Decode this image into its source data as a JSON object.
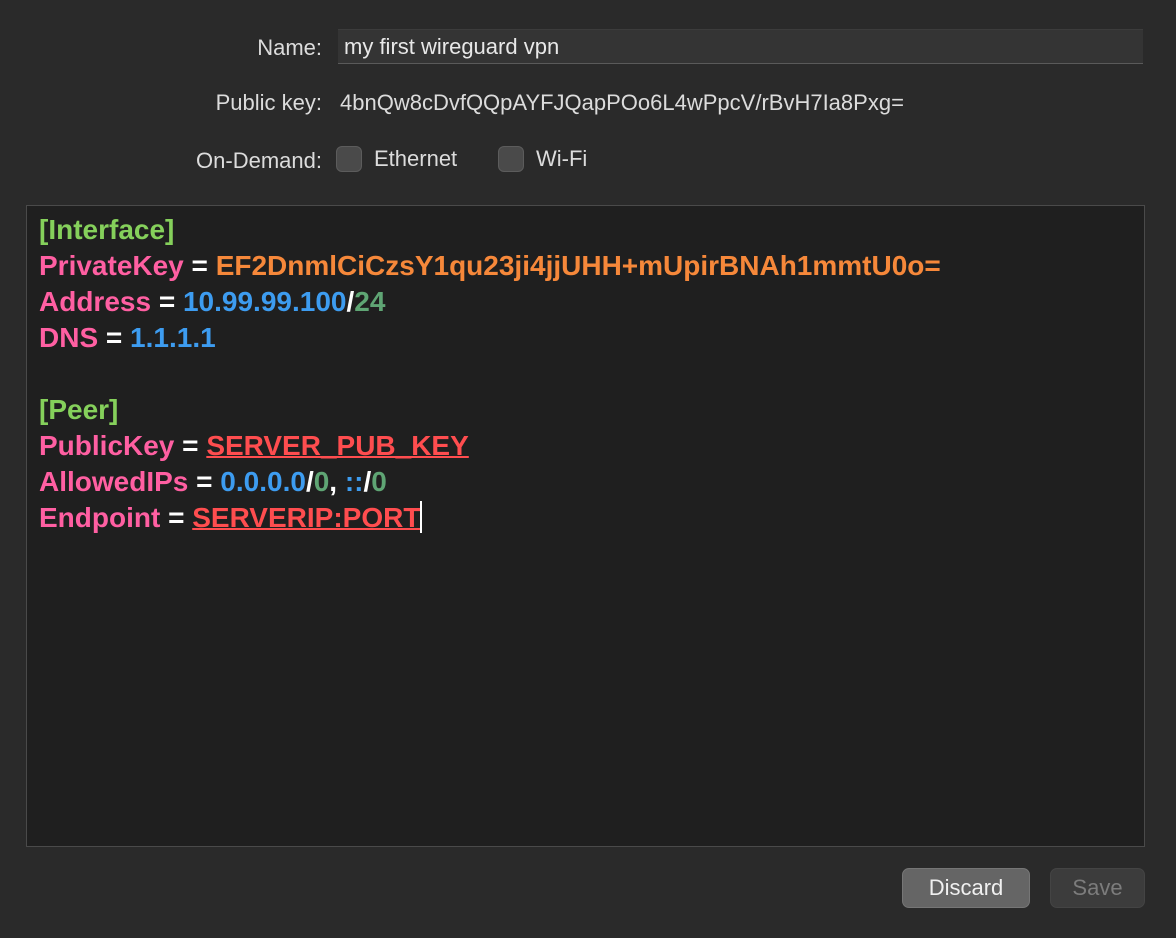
{
  "form": {
    "name_label": "Name:",
    "name_value": "my first wireguard vpn",
    "pubkey_label": "Public key:",
    "pubkey_value": "4bnQw8cDvfQQpAYFJQapPOo6L4wPpcV/rBvH7Ia8Pxg=",
    "ondemand_label": "On-Demand:",
    "ethernet_label": "Ethernet",
    "ethernet_checked": false,
    "wifi_label": "Wi-Fi",
    "wifi_checked": false
  },
  "config": {
    "interface_header": "[Interface]",
    "private_key_key": "PrivateKey",
    "private_key_value": "EF2DnmlCiCzsY1qu23ji4jjUHH+mUpirBNAh1mmtU0o=",
    "address_key": "Address",
    "address_ip": "10.99.99.100",
    "address_slash": "/",
    "address_prefix": "24",
    "dns_key": "DNS",
    "dns_value": "1.1.1.1",
    "peer_header": "[Peer]",
    "public_key_key": "PublicKey",
    "public_key_value": "SERVER_PUB_KEY",
    "allowed_ips_key": "AllowedIPs",
    "allowed_ip4": "0.0.0.0",
    "allowed_ip4_prefix": "0",
    "allowed_ip6": "::",
    "allowed_ip6_prefix": "0",
    "endpoint_key": "Endpoint",
    "endpoint_value": "SERVERIP:PORT",
    "equals": " = ",
    "comma": ", "
  },
  "buttons": {
    "discard_label": "Discard",
    "save_label": "Save"
  },
  "colors": {
    "background": "#2a2a2a",
    "editor_background": "#1f1f1f",
    "section": "#85d05b",
    "key": "#ff5fa2",
    "private_key_value": "#f6883a",
    "ip_value": "#3d9cf0",
    "cidr_prefix": "#5fa574",
    "invalid_value": "#ff4d4f"
  }
}
